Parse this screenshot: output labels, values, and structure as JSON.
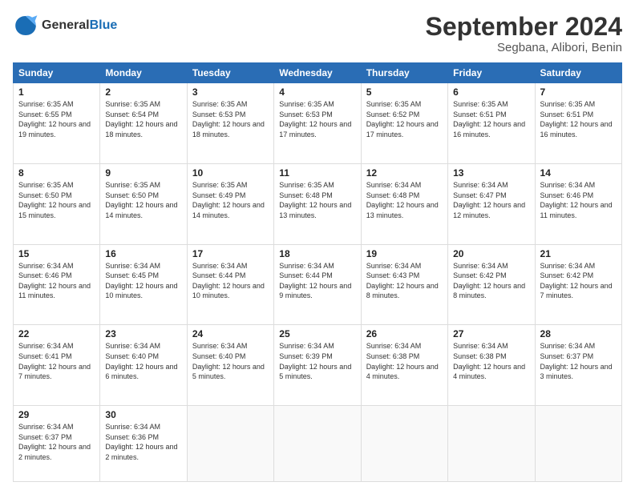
{
  "logo": {
    "line1": "General",
    "line2": "Blue"
  },
  "title": {
    "month_year": "September 2024",
    "location": "Segbana, Alibori, Benin"
  },
  "weekdays": [
    "Sunday",
    "Monday",
    "Tuesday",
    "Wednesday",
    "Thursday",
    "Friday",
    "Saturday"
  ],
  "weeks": [
    [
      {
        "day": "1",
        "sunrise": "6:35 AM",
        "sunset": "6:55 PM",
        "daylight": "12 hours and 19 minutes."
      },
      {
        "day": "2",
        "sunrise": "6:35 AM",
        "sunset": "6:54 PM",
        "daylight": "12 hours and 18 minutes."
      },
      {
        "day": "3",
        "sunrise": "6:35 AM",
        "sunset": "6:53 PM",
        "daylight": "12 hours and 18 minutes."
      },
      {
        "day": "4",
        "sunrise": "6:35 AM",
        "sunset": "6:53 PM",
        "daylight": "12 hours and 17 minutes."
      },
      {
        "day": "5",
        "sunrise": "6:35 AM",
        "sunset": "6:52 PM",
        "daylight": "12 hours and 17 minutes."
      },
      {
        "day": "6",
        "sunrise": "6:35 AM",
        "sunset": "6:51 PM",
        "daylight": "12 hours and 16 minutes."
      },
      {
        "day": "7",
        "sunrise": "6:35 AM",
        "sunset": "6:51 PM",
        "daylight": "12 hours and 16 minutes."
      }
    ],
    [
      {
        "day": "8",
        "sunrise": "6:35 AM",
        "sunset": "6:50 PM",
        "daylight": "12 hours and 15 minutes."
      },
      {
        "day": "9",
        "sunrise": "6:35 AM",
        "sunset": "6:50 PM",
        "daylight": "12 hours and 14 minutes."
      },
      {
        "day": "10",
        "sunrise": "6:35 AM",
        "sunset": "6:49 PM",
        "daylight": "12 hours and 14 minutes."
      },
      {
        "day": "11",
        "sunrise": "6:35 AM",
        "sunset": "6:48 PM",
        "daylight": "12 hours and 13 minutes."
      },
      {
        "day": "12",
        "sunrise": "6:34 AM",
        "sunset": "6:48 PM",
        "daylight": "12 hours and 13 minutes."
      },
      {
        "day": "13",
        "sunrise": "6:34 AM",
        "sunset": "6:47 PM",
        "daylight": "12 hours and 12 minutes."
      },
      {
        "day": "14",
        "sunrise": "6:34 AM",
        "sunset": "6:46 PM",
        "daylight": "12 hours and 11 minutes."
      }
    ],
    [
      {
        "day": "15",
        "sunrise": "6:34 AM",
        "sunset": "6:46 PM",
        "daylight": "12 hours and 11 minutes."
      },
      {
        "day": "16",
        "sunrise": "6:34 AM",
        "sunset": "6:45 PM",
        "daylight": "12 hours and 10 minutes."
      },
      {
        "day": "17",
        "sunrise": "6:34 AM",
        "sunset": "6:44 PM",
        "daylight": "12 hours and 10 minutes."
      },
      {
        "day": "18",
        "sunrise": "6:34 AM",
        "sunset": "6:44 PM",
        "daylight": "12 hours and 9 minutes."
      },
      {
        "day": "19",
        "sunrise": "6:34 AM",
        "sunset": "6:43 PM",
        "daylight": "12 hours and 8 minutes."
      },
      {
        "day": "20",
        "sunrise": "6:34 AM",
        "sunset": "6:42 PM",
        "daylight": "12 hours and 8 minutes."
      },
      {
        "day": "21",
        "sunrise": "6:34 AM",
        "sunset": "6:42 PM",
        "daylight": "12 hours and 7 minutes."
      }
    ],
    [
      {
        "day": "22",
        "sunrise": "6:34 AM",
        "sunset": "6:41 PM",
        "daylight": "12 hours and 7 minutes."
      },
      {
        "day": "23",
        "sunrise": "6:34 AM",
        "sunset": "6:40 PM",
        "daylight": "12 hours and 6 minutes."
      },
      {
        "day": "24",
        "sunrise": "6:34 AM",
        "sunset": "6:40 PM",
        "daylight": "12 hours and 5 minutes."
      },
      {
        "day": "25",
        "sunrise": "6:34 AM",
        "sunset": "6:39 PM",
        "daylight": "12 hours and 5 minutes."
      },
      {
        "day": "26",
        "sunrise": "6:34 AM",
        "sunset": "6:38 PM",
        "daylight": "12 hours and 4 minutes."
      },
      {
        "day": "27",
        "sunrise": "6:34 AM",
        "sunset": "6:38 PM",
        "daylight": "12 hours and 4 minutes."
      },
      {
        "day": "28",
        "sunrise": "6:34 AM",
        "sunset": "6:37 PM",
        "daylight": "12 hours and 3 minutes."
      }
    ],
    [
      {
        "day": "29",
        "sunrise": "6:34 AM",
        "sunset": "6:37 PM",
        "daylight": "12 hours and 2 minutes."
      },
      {
        "day": "30",
        "sunrise": "6:34 AM",
        "sunset": "6:36 PM",
        "daylight": "12 hours and 2 minutes."
      },
      null,
      null,
      null,
      null,
      null
    ]
  ],
  "labels": {
    "sunrise": "Sunrise: ",
    "sunset": "Sunset: ",
    "daylight": "Daylight: "
  }
}
